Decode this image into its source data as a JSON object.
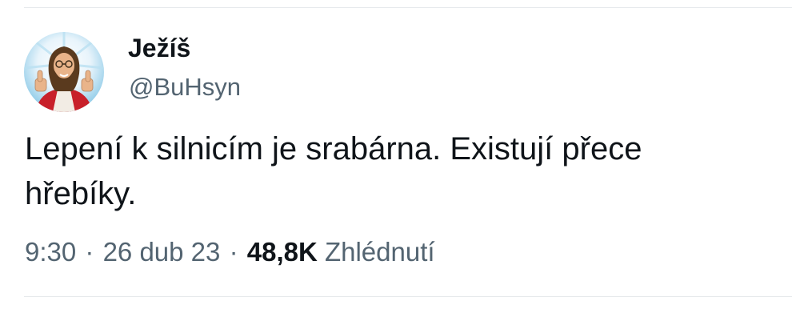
{
  "tweet": {
    "author": {
      "display_name": "Ježíš",
      "handle": "@BuHsyn",
      "avatar_icon": "profile-avatar"
    },
    "text_line1": "Lepení k silnicím je srabárna. Existují přece",
    "text_line2": "hřebíky.",
    "meta": {
      "time": "9:30",
      "date": "26 dub 23",
      "separator": "·",
      "views_count": "48,8K",
      "views_label": "Zhlédnutí"
    }
  },
  "colors": {
    "text_primary": "#0f1419",
    "text_secondary": "#536471",
    "divider": "#e6e9ec"
  }
}
